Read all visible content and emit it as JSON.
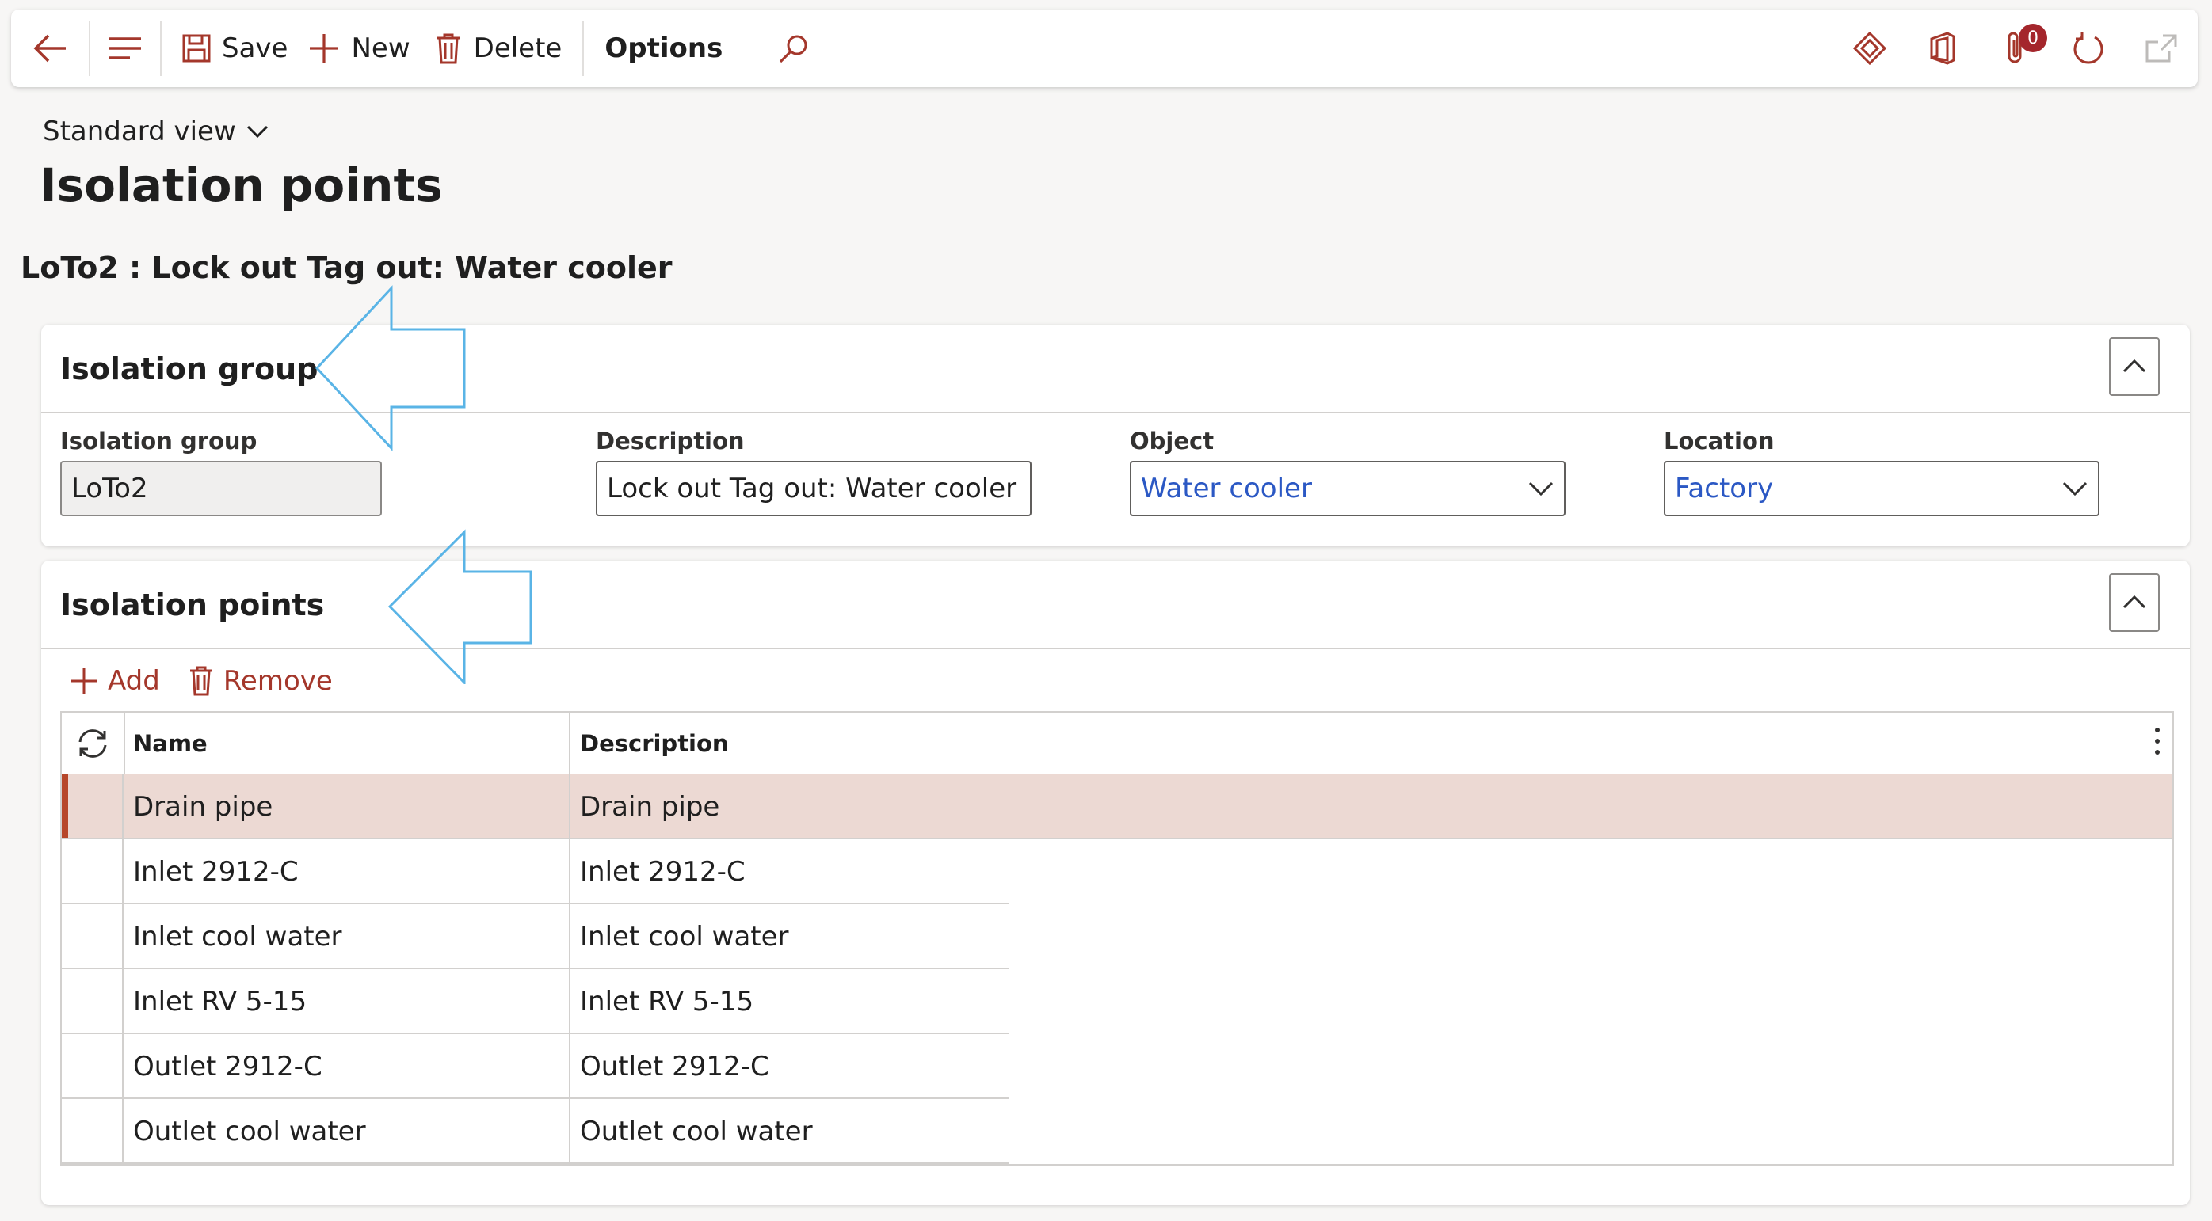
{
  "toolbar": {
    "save_label": "Save",
    "new_label": "New",
    "delete_label": "Delete",
    "options_label": "Options",
    "notification_count": "0"
  },
  "view_selector": "Standard view",
  "page_title": "Isolation points",
  "record_title": "LoTo2 : Lock out Tag out: Water cooler",
  "isolation_group_section": {
    "title": "Isolation group",
    "fields": {
      "group_label": "Isolation group",
      "group_value": "LoTo2",
      "description_label": "Description",
      "description_value": "Lock out Tag out: Water cooler",
      "object_label": "Object",
      "object_value": "Water cooler",
      "location_label": "Location",
      "location_value": "Factory"
    }
  },
  "isolation_points_section": {
    "title": "Isolation points",
    "add_label": "Add",
    "remove_label": "Remove",
    "columns": [
      "Name",
      "Description"
    ],
    "rows": [
      {
        "name": "Drain pipe",
        "description": "Drain pipe",
        "selected": true
      },
      {
        "name": "Inlet 2912-C",
        "description": "Inlet 2912-C"
      },
      {
        "name": "Inlet cool water",
        "description": "Inlet cool water"
      },
      {
        "name": "Inlet RV 5-15",
        "description": "Inlet RV 5-15"
      },
      {
        "name": "Outlet 2912-C",
        "description": "Outlet 2912-C"
      },
      {
        "name": "Outlet cool water",
        "description": "Outlet cool water"
      }
    ]
  },
  "colors": {
    "accent": "#a4372b",
    "selected_row": "#ecd9d3",
    "lookup_text": "#2b58c4",
    "annotation_arrow": "#5ab4e6"
  }
}
